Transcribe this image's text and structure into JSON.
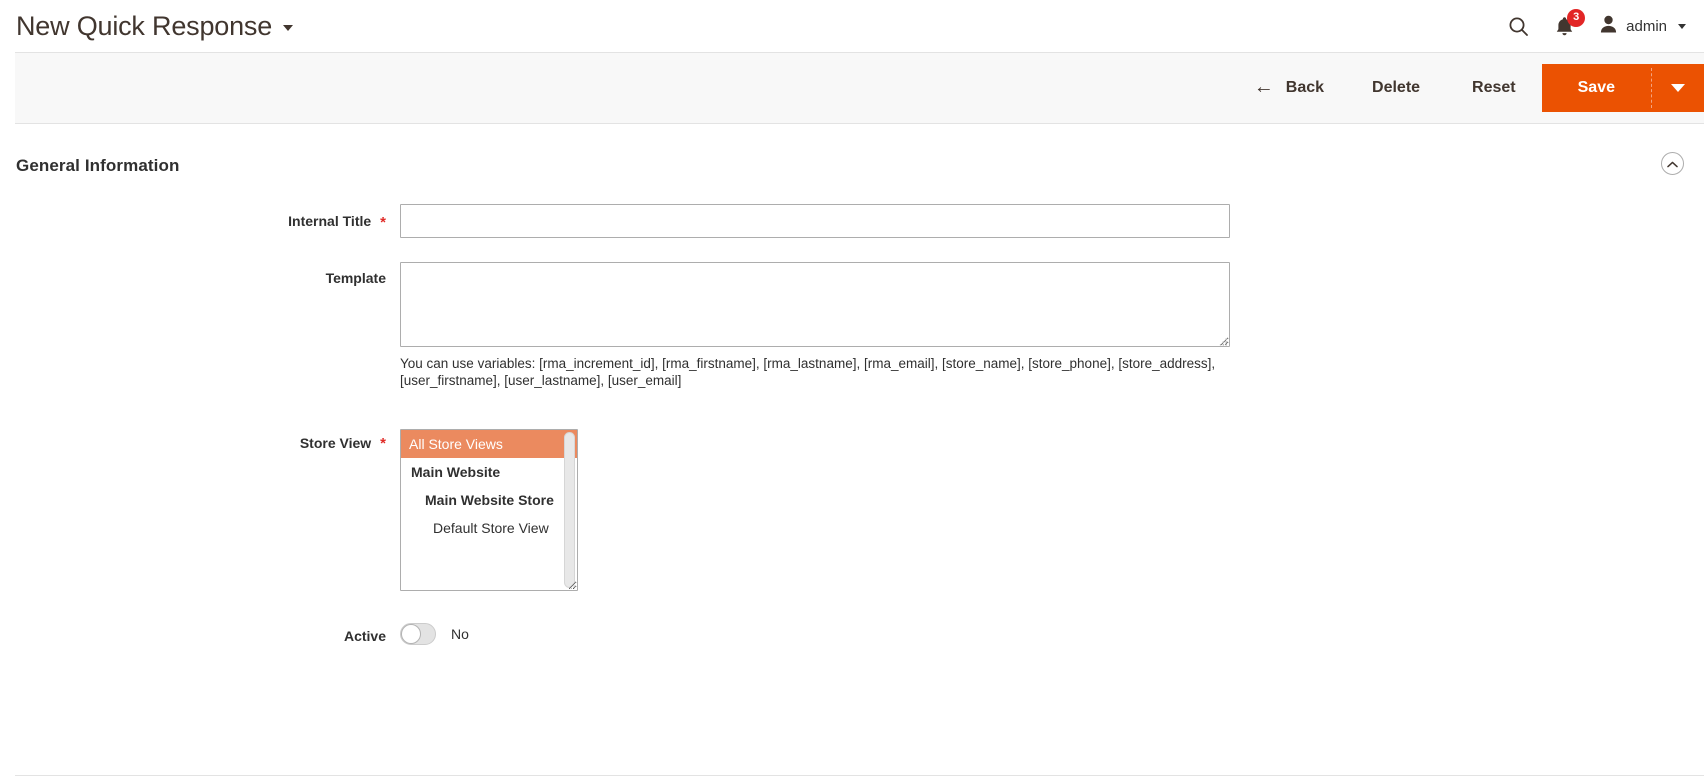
{
  "header": {
    "title": "New Quick Response",
    "title_caret_icon": "chevron-down-icon",
    "search_icon": "search-icon",
    "notifications_icon": "bell-icon",
    "notifications_count": "3",
    "avatar_icon": "user-avatar-icon",
    "admin_label": "admin",
    "admin_caret_icon": "chevron-down-icon"
  },
  "toolbar": {
    "back_label": "Back",
    "back_icon": "arrow-left-icon",
    "delete_label": "Delete",
    "reset_label": "Reset",
    "save_label": "Save",
    "save_caret_icon": "chevron-down-icon",
    "save_color": "#eb5202"
  },
  "section": {
    "title": "General Information",
    "collapse_icon": "chevron-up-icon"
  },
  "form": {
    "internal_title": {
      "label": "Internal Title",
      "required": "*",
      "value": "",
      "placeholder": ""
    },
    "template": {
      "label": "Template",
      "value": "",
      "placeholder": "",
      "note_line1": "You can use variables: [rma_increment_id], [rma_firstname], [rma_lastname], [rma_email], [store_name], [store_phone], [store_address],",
      "note_line2": "[user_firstname], [user_lastname], [user_email]"
    },
    "store_view": {
      "label": "Store View",
      "required": "*",
      "selected_color": "#eb8a5f",
      "options": [
        {
          "label": "All Store Views",
          "level": 0,
          "selected": true
        },
        {
          "label": "Main Website",
          "level": 1,
          "selected": false
        },
        {
          "label": "Main Website Store",
          "level": 2,
          "selected": false
        },
        {
          "label": "Default Store View",
          "level": 3,
          "selected": false
        }
      ]
    },
    "active": {
      "label": "Active",
      "state_label": "No",
      "checked": false
    }
  }
}
